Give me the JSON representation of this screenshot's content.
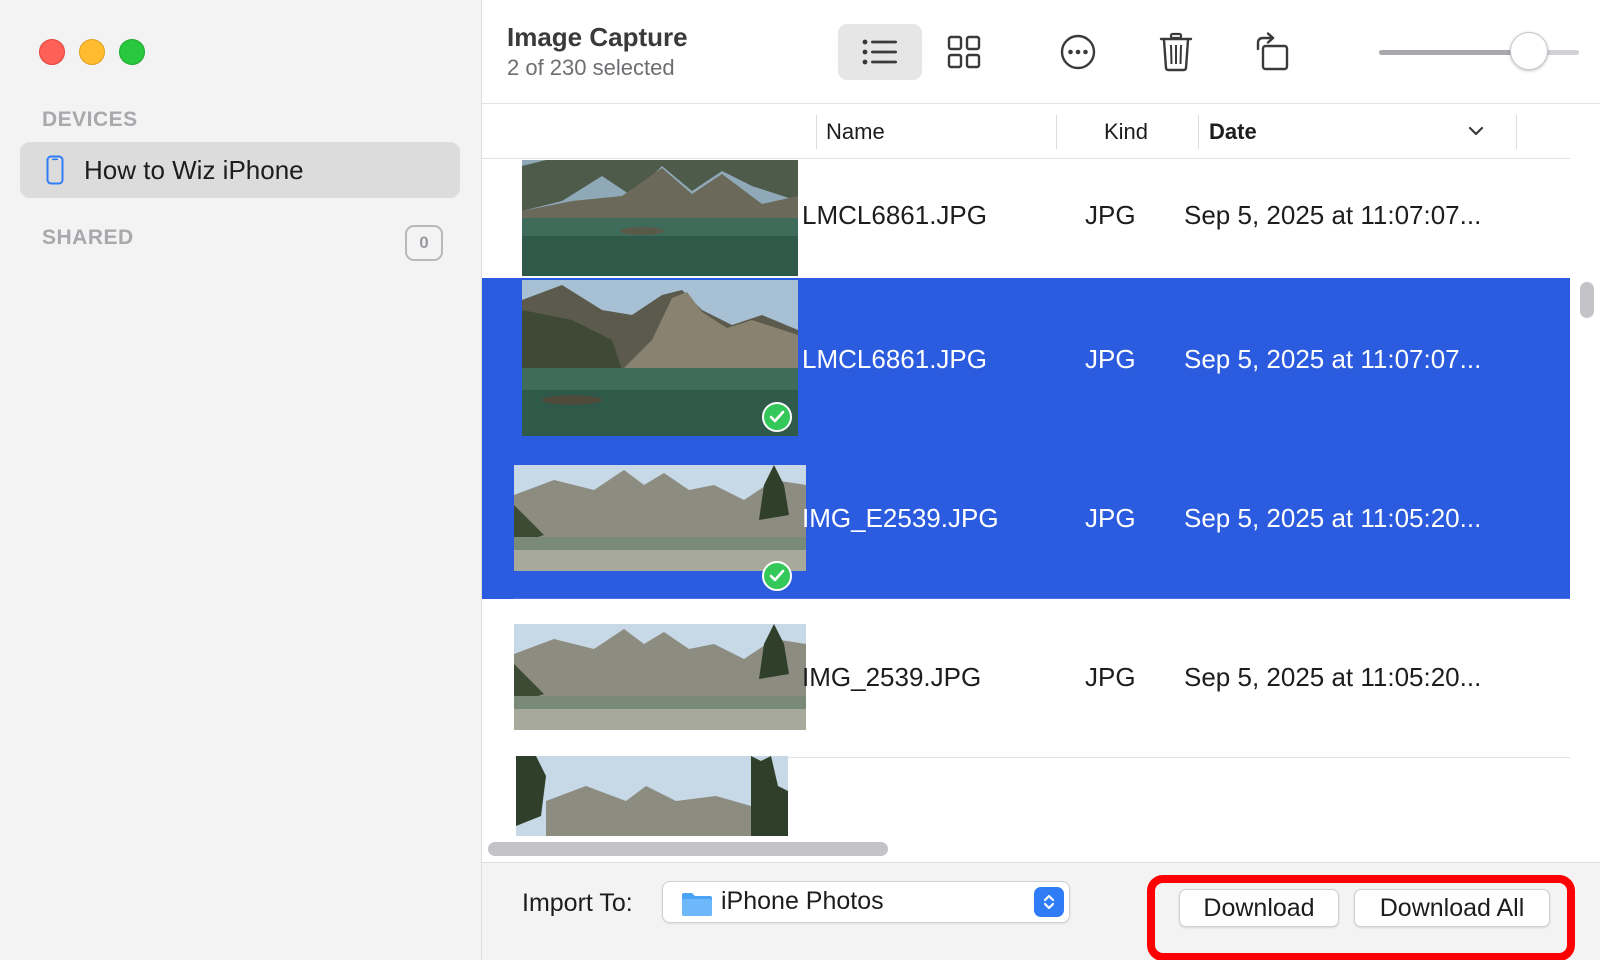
{
  "window": {
    "title": "Image Capture",
    "subtitle": "2 of 230 selected"
  },
  "sidebar": {
    "devices_heading": "DEVICES",
    "device_name": "How to Wiz iPhone",
    "shared_heading": "SHARED",
    "shared_count": "0"
  },
  "toolbar": {
    "list_view_icon": "list-icon",
    "grid_view_icon": "grid-icon",
    "more_icon": "ellipsis-circle-icon",
    "delete_icon": "trash-icon",
    "rotate_icon": "rotate-left-icon",
    "thumbnail_size_fraction": 0.75
  },
  "columns": {
    "name": "Name",
    "kind": "Kind",
    "date": "Date"
  },
  "files": [
    {
      "name": "LMCL6861.JPG",
      "kind": "JPG",
      "date": "Sep 5, 2025 at 11:07:07...",
      "selected": false
    },
    {
      "name": "LMCL6861.JPG",
      "kind": "JPG",
      "date": "Sep 5, 2025 at 11:07:07...",
      "selected": true
    },
    {
      "name": "IMG_E2539.JPG",
      "kind": "JPG",
      "date": "Sep 5, 2025 at 11:05:20...",
      "selected": true
    },
    {
      "name": "IMG_2539.JPG",
      "kind": "JPG",
      "date": "Sep 5, 2025 at 11:05:20...",
      "selected": false
    },
    {
      "name": "",
      "kind": "",
      "date": "",
      "selected": false
    }
  ],
  "footer": {
    "import_label": "Import To:",
    "import_destination": "iPhone Photos",
    "download_label": "Download",
    "download_all_label": "Download All"
  },
  "colors": {
    "selection": "#2b5bde",
    "check": "#34c759",
    "highlight": "#ff0000",
    "accent": "#2f7cf6"
  }
}
